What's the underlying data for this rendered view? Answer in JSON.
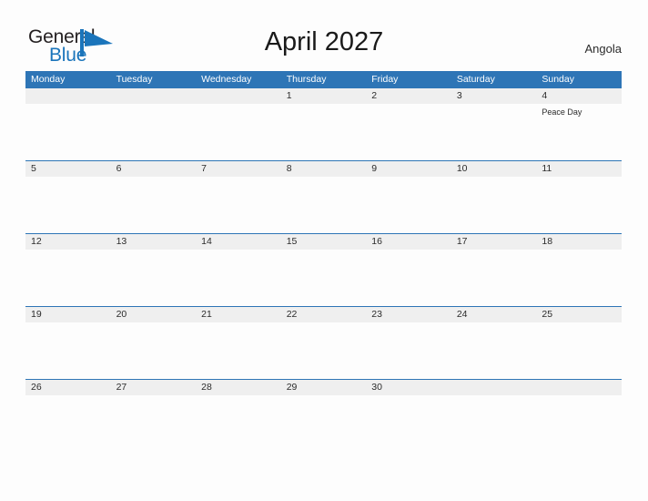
{
  "brand": {
    "word_one": "General",
    "word_two": "Blue",
    "flag_icon": "blue-pennant-flag",
    "color_dark": "#231f20",
    "color_blue": "#1b75bb"
  },
  "header": {
    "title": "April 2027",
    "region": "Angola"
  },
  "theme": {
    "header_blue": "#2e75b6",
    "date_band_gray": "#efefef",
    "page_background": "#fdfdfd",
    "text_color": "#2b2b2b"
  },
  "calendar": {
    "month": "April",
    "year": "2027",
    "weekday_headers": [
      "Monday",
      "Tuesday",
      "Wednesday",
      "Thursday",
      "Friday",
      "Saturday",
      "Sunday"
    ],
    "weeks": [
      {
        "days": [
          {
            "date": "",
            "events": []
          },
          {
            "date": "",
            "events": []
          },
          {
            "date": "",
            "events": []
          },
          {
            "date": "1",
            "events": []
          },
          {
            "date": "2",
            "events": []
          },
          {
            "date": "3",
            "events": []
          },
          {
            "date": "4",
            "events": [
              "Peace Day"
            ]
          }
        ]
      },
      {
        "days": [
          {
            "date": "5",
            "events": []
          },
          {
            "date": "6",
            "events": []
          },
          {
            "date": "7",
            "events": []
          },
          {
            "date": "8",
            "events": []
          },
          {
            "date": "9",
            "events": []
          },
          {
            "date": "10",
            "events": []
          },
          {
            "date": "11",
            "events": []
          }
        ]
      },
      {
        "days": [
          {
            "date": "12",
            "events": []
          },
          {
            "date": "13",
            "events": []
          },
          {
            "date": "14",
            "events": []
          },
          {
            "date": "15",
            "events": []
          },
          {
            "date": "16",
            "events": []
          },
          {
            "date": "17",
            "events": []
          },
          {
            "date": "18",
            "events": []
          }
        ]
      },
      {
        "days": [
          {
            "date": "19",
            "events": []
          },
          {
            "date": "20",
            "events": []
          },
          {
            "date": "21",
            "events": []
          },
          {
            "date": "22",
            "events": []
          },
          {
            "date": "23",
            "events": []
          },
          {
            "date": "24",
            "events": []
          },
          {
            "date": "25",
            "events": []
          }
        ]
      },
      {
        "days": [
          {
            "date": "26",
            "events": []
          },
          {
            "date": "27",
            "events": []
          },
          {
            "date": "28",
            "events": []
          },
          {
            "date": "29",
            "events": []
          },
          {
            "date": "30",
            "events": []
          },
          {
            "date": "",
            "events": []
          },
          {
            "date": "",
            "events": []
          }
        ]
      }
    ]
  }
}
